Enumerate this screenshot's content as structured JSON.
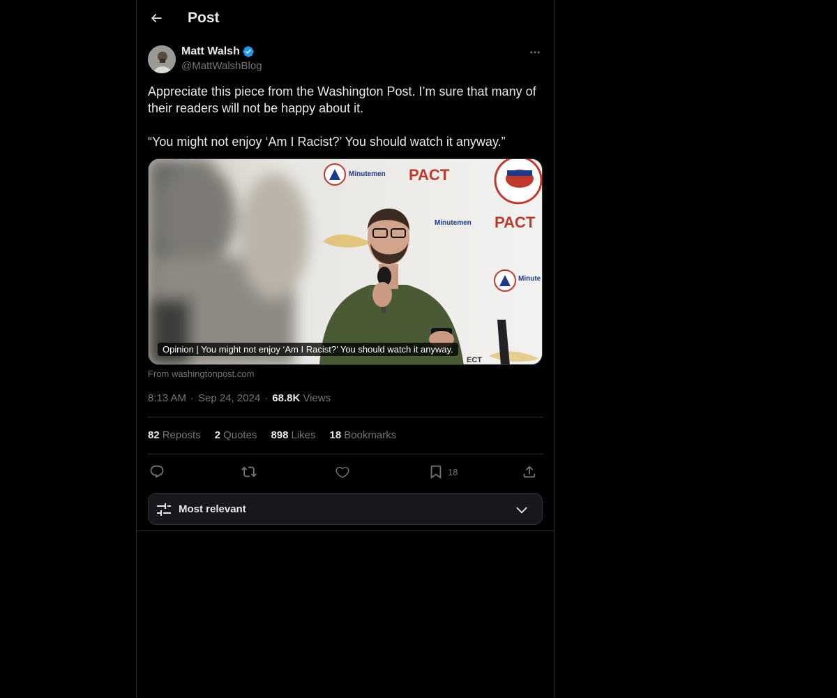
{
  "header": {
    "title": "Post",
    "back_icon": "arrow-left-icon"
  },
  "author": {
    "name": "Matt Walsh",
    "handle": "@MattWalshBlog",
    "verified": true,
    "verified_color": "#1d9bf0",
    "avatar_icon": "avatar"
  },
  "post": {
    "line1": "Appreciate this piece from the Washington Post. I’m sure that many of their readers will not be happy about it.",
    "line2": "“You might not enjoy ‘Am I Racist?’ You should watch it anyway.”"
  },
  "card": {
    "caption": "Opinion | You might not enjoy ‘Am I Racist?’ You should watch it anyway.",
    "source": "From washingtonpost.com",
    "image_text": {
      "logo1": "Minutemen",
      "logo2": "PACT",
      "logo3": "Minutemen",
      "logo4": "PACT",
      "logo5": "Minute",
      "logo6": "ECT"
    }
  },
  "meta": {
    "time": "8:13 AM",
    "date": "Sep 24, 2024",
    "views_count": "68.8K",
    "views_label": "Views"
  },
  "stats": {
    "reposts_count": "82",
    "reposts_label": "Reposts",
    "quotes_count": "2",
    "quotes_label": "Quotes",
    "likes_count": "898",
    "likes_label": "Likes",
    "bookmarks_count": "18",
    "bookmarks_label": "Bookmarks"
  },
  "actions": {
    "bookmark_count": "18",
    "icons": [
      "reply-icon",
      "repost-icon",
      "like-icon",
      "bookmark-icon",
      "share-icon"
    ]
  },
  "sort": {
    "label": "Most relevant"
  },
  "colors": {
    "background": "#000000",
    "text": "#e7e9ea",
    "muted": "#71767b",
    "border": "#2f3336",
    "accent": "#1d9bf0"
  }
}
